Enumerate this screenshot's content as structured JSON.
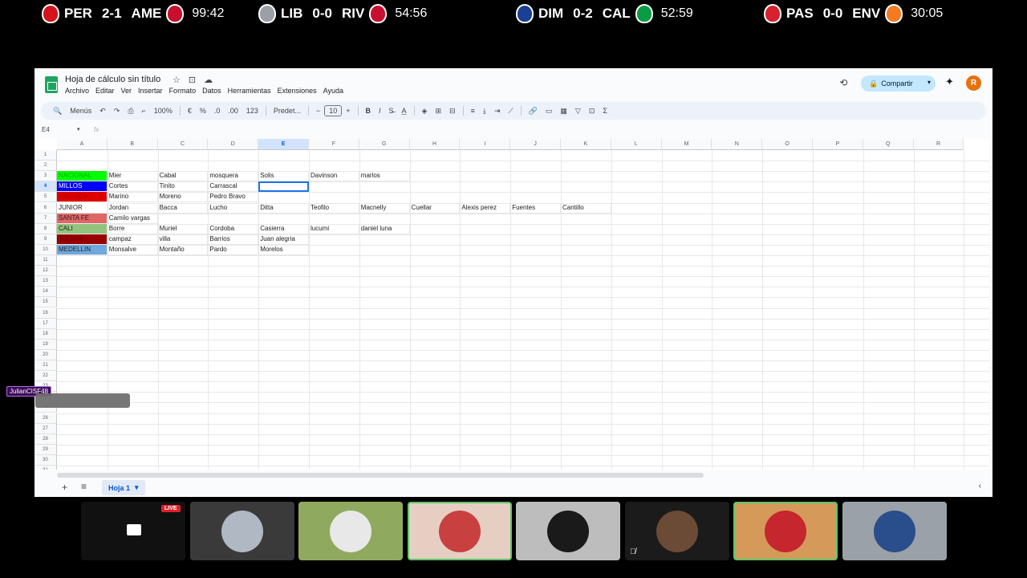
{
  "scoreboard": [
    {
      "home": "PER",
      "score": "2-1",
      "away": "AME",
      "clock": "99:42",
      "home_color": "#d4141c",
      "away_color": "#c8102e"
    },
    {
      "home": "LIB",
      "score": "0-0",
      "away": "RIV",
      "clock": "54:56",
      "home_color": "#9aa0a6",
      "away_color": "#c8102e"
    },
    {
      "home": "DIM",
      "score": "0-2",
      "away": "CAL",
      "clock": "52:59",
      "home_color": "#1b3f95",
      "away_color": "#0a9b45"
    },
    {
      "home": "PAS",
      "score": "0-0",
      "away": "ENV",
      "clock": "30:05",
      "home_color": "#d8202f",
      "away_color": "#f47b20"
    }
  ],
  "sheets_app": {
    "title": "Hoja de cálculo sin título",
    "menu": [
      "Archivo",
      "Editar",
      "Ver",
      "Insertar",
      "Formato",
      "Datos",
      "Herramientas",
      "Extensiones",
      "Ayuda"
    ],
    "share_label": "Compartir",
    "avatar_letter": "R",
    "toolbar": {
      "menus_label": "Menús",
      "zoom": "100%",
      "currency": "€",
      "percent": "%",
      "dec_less": ".0",
      "dec_more": ".00",
      "num_fmt": "123",
      "font": "Predet...",
      "font_size": "10"
    },
    "name_box": "E4",
    "fx": "fx",
    "columns": [
      "A",
      "B",
      "C",
      "D",
      "E",
      "F",
      "G",
      "H",
      "I",
      "J",
      "K",
      "L",
      "M",
      "N",
      "O",
      "P",
      "Q",
      "R"
    ],
    "row_numbers": [
      "1",
      "2",
      "3",
      "4",
      "5",
      "6",
      "7",
      "8",
      "9",
      "10",
      "11",
      "12",
      "13",
      "14",
      "15",
      "16",
      "17",
      "18",
      "19",
      "20",
      "21",
      "22",
      "23",
      "24",
      "25",
      "26",
      "27",
      "28",
      "29",
      "30",
      "31"
    ],
    "rows": [
      {
        "row": 3,
        "cells": [
          "NACIONAL",
          "Mier",
          "Cabal",
          "mosquera",
          "Solis",
          "Davinson",
          "marlos"
        ],
        "fill": "#00ff00",
        "text_color": "#00b000"
      },
      {
        "row": 4,
        "cells": [
          "MILLOS",
          "Cortes",
          "Tinito",
          "Carrascal",
          "",
          "",
          ""
        ],
        "fill": "#0000ff",
        "text_color": "#ffffff"
      },
      {
        "row": 5,
        "cells": [
          "AMERICA",
          "Marino",
          "Moreno",
          "Pedro Bravo",
          "",
          "",
          ""
        ],
        "fill": "#e00000",
        "text_color": "#b00000"
      },
      {
        "row": 6,
        "cells": [
          "JUNIOR",
          "Jordan",
          "Bacca",
          "Lucho",
          "Ditta",
          "Teofilo",
          "Macnelly",
          "Cuellar",
          "Alexis perez",
          "Fuentes",
          "Cantillo"
        ],
        "fill": "#ffffff",
        "text_color": "#202124"
      },
      {
        "row": 7,
        "cells": [
          "SANTA FE",
          "Camilo vargas"
        ],
        "fill": "#e06666",
        "text_color": "#202124"
      },
      {
        "row": 8,
        "cells": [
          "CALI",
          "Borre",
          "Muriel",
          "Cordoba",
          "Casierra",
          "lucumi",
          "daniel luna"
        ],
        "fill": "#93c47d",
        "text_color": "#202124"
      },
      {
        "row": 9,
        "cells": [
          "TOLIMA",
          "campaz",
          "villa",
          "Barrios",
          "Juan alegria"
        ],
        "fill": "#990000",
        "text_color": "#6a0000"
      },
      {
        "row": 10,
        "cells": [
          "MEDELLIN",
          "Monsalve",
          "Montaño",
          "Pardo",
          "Morelos"
        ],
        "fill": "#6fa8dc",
        "text_color": "#202124"
      }
    ],
    "sheet_tab": "Hoja 1"
  },
  "chat": {
    "username": "JulianCISF48"
  },
  "call": {
    "live_label": "LIVE"
  }
}
